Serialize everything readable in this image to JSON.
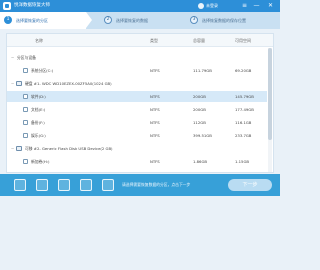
{
  "titlebar": {
    "title": "悦洋数据恢复大师",
    "user": "未登录",
    "menu_glyph": "≡",
    "minimize_glyph": "—",
    "close_glyph": "✕"
  },
  "steps": [
    {
      "number": "1",
      "label": "选择要恢复的分区"
    },
    {
      "number": "2",
      "label": "选择要恢复的数据"
    },
    {
      "number": "3",
      "label": "选择恢复数据的保存位置"
    }
  ],
  "table": {
    "headers": {
      "name": "名称",
      "type": "类型",
      "total": "总容量",
      "free": "可用空间"
    },
    "rows": [
      {
        "kind": "group",
        "name": "分区与设备",
        "type": "",
        "total": "",
        "free": ""
      },
      {
        "kind": "volume",
        "name": "系统分区(C:)",
        "type": "NTFS",
        "total": "111.79GB",
        "free": "69.20GB"
      },
      {
        "kind": "disk",
        "name": "硬盘 #1- WDC WD10EZEX-00ZF5A0(1024 GB)",
        "type": "",
        "total": "",
        "free": ""
      },
      {
        "kind": "volume",
        "name": "软件(D:)",
        "type": "NTFS",
        "total": "200GB",
        "free": "145.79GB",
        "selected": true
      },
      {
        "kind": "volume",
        "name": "文档(E:)",
        "type": "NTFS",
        "total": "200GB",
        "free": "177.49GB"
      },
      {
        "kind": "volume",
        "name": "备份(F:)",
        "type": "NTFS",
        "total": "112GB",
        "free": "116.1GB"
      },
      {
        "kind": "volume",
        "name": "娱乐(G:)",
        "type": "NTFS",
        "total": "399.51GB",
        "free": "233.7GB"
      },
      {
        "kind": "disk",
        "name": "可移 #2- Generic Flash Disk USB Device(2 GB)",
        "type": "",
        "total": "",
        "free": ""
      },
      {
        "kind": "volume",
        "name": "新加卷(H:)",
        "type": "NTFS",
        "total": "1.86GB",
        "free": "1.15GB"
      }
    ]
  },
  "footer": {
    "tip": "请选择需要恢复数据的分区，点击下一步",
    "next_button": "下一步"
  },
  "colors": {
    "brand": "#2d8fd8",
    "footer": "#37a0d8",
    "selected_row": "#d6e9f8"
  }
}
